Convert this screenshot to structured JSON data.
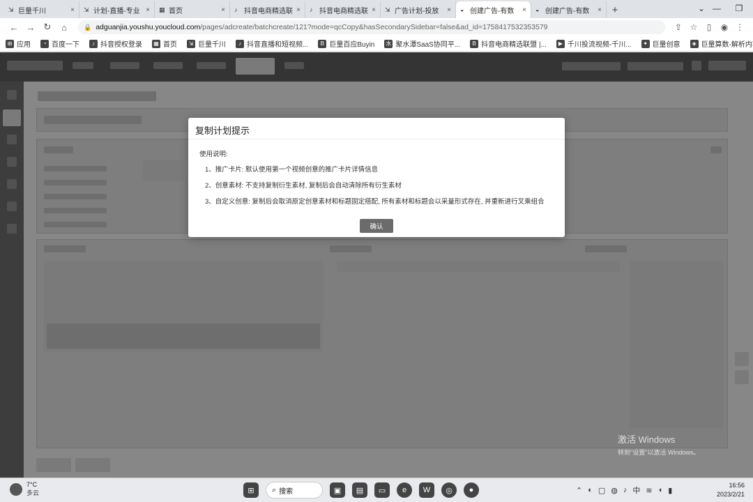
{
  "browser": {
    "tabs": [
      {
        "label": "巨量千川",
        "icon": "qianchuan-icon"
      },
      {
        "label": "计划-直播-专业",
        "icon": "qianchuan-icon"
      },
      {
        "label": "首页",
        "icon": "page-icon"
      },
      {
        "label": "抖音电商精选联",
        "icon": "douyin-icon"
      },
      {
        "label": "抖音电商精选联",
        "icon": "douyin-icon"
      },
      {
        "label": "广告计划-投放",
        "icon": "qianchuan-icon"
      },
      {
        "label": "创建广告-有数",
        "icon": "youshu-icon"
      },
      {
        "label": "创建广告-有数",
        "icon": "youshu-icon"
      }
    ],
    "new_tab_label": "+",
    "url_host": "adguanjia.youshu.youcloud.com",
    "url_path": "/pages/adcreate/batchcreate/121?mode=qcCopy&hasSecondarySidebar=false&ad_id=1758417532353579",
    "bookmarks": [
      {
        "label": "应用",
        "icon": "apps-grid-icon"
      },
      {
        "label": "百度一下",
        "icon": "baidu-icon"
      },
      {
        "label": "抖音授权登录",
        "icon": "douyin-icon"
      },
      {
        "label": "首页",
        "icon": "page-icon"
      },
      {
        "label": "巨量千川",
        "icon": "qianchuan-icon"
      },
      {
        "label": "抖音直播和短视频...",
        "icon": "douyin-icon"
      },
      {
        "label": "巨量百应Buyin",
        "icon": "buyin-icon"
      },
      {
        "label": "聚水潭SaaS协同平...",
        "icon": "jushuitan-icon"
      },
      {
        "label": "抖音电商精选联盟 |...",
        "icon": "buyin-icon"
      },
      {
        "label": "千川投流视频-千川...",
        "icon": "video-icon"
      },
      {
        "label": "巨量创意",
        "icon": "chuangyi-icon"
      },
      {
        "label": "巨量算数-解析内容...",
        "icon": "suanshu-icon"
      }
    ]
  },
  "dialog": {
    "title": "复制计划提示",
    "usage_label": "使用说明:",
    "items": [
      "1、推广卡片: 默认使用第一个视频创意的推广卡片详情信息",
      "2、创意素材: 不支持复制衍生素材, 复制后会自动清除所有衍生素材",
      "3、自定义创意: 复制后会取消原定创意素材和标题固定搭配, 所有素材和标题会以采量形式存在, 并重新进行叉乘组合"
    ],
    "confirm_label": "确认"
  },
  "watermark": {
    "line1": "激活 Windows",
    "line2": "转到\"设置\"以激活 Windows。"
  },
  "taskbar": {
    "weather_temp": "7°C",
    "weather_desc": "多云",
    "search_label": "搜索",
    "time": "16:56",
    "date": "2023/2/21",
    "ime_label": "中"
  },
  "colors": {
    "tab_strip": "#dfe3e8",
    "overlay": "rgba(0,0,0,0.42)",
    "confirm_button": "#6b6b6b"
  }
}
